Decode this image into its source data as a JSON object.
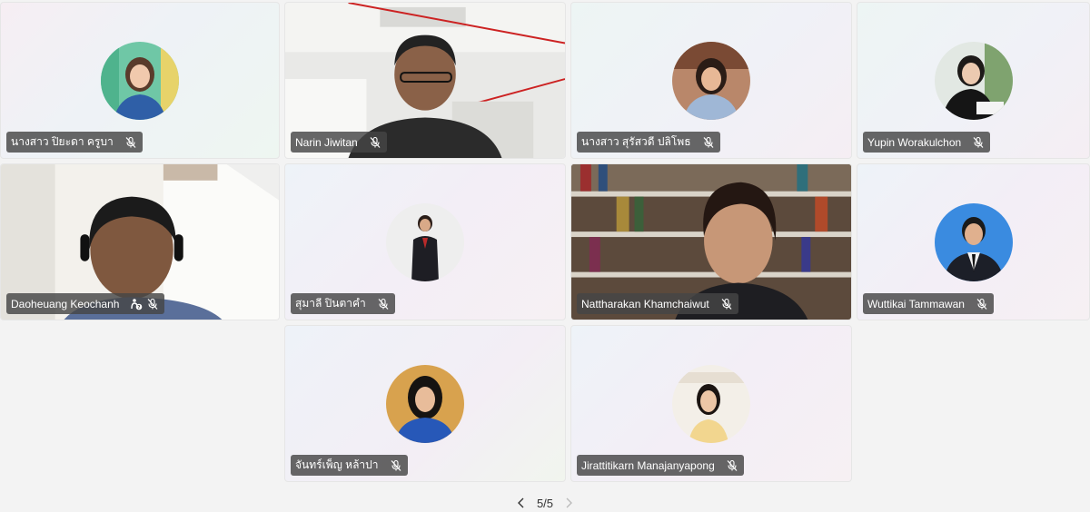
{
  "participants": [
    {
      "name": "นางสาว ปิยะดา ครูบา",
      "muted": true
    },
    {
      "name": "Narin Jiwitan",
      "muted": true
    },
    {
      "name": "นางสาว สุรัสวดี ปลิโพธ",
      "muted": true
    },
    {
      "name": "Yupin Worakulchon",
      "muted": true
    },
    {
      "name": "Daoheuang Keochanh",
      "muted": true,
      "extra_icon": "raise-hand-question-icon"
    },
    {
      "name": "สุมาลี ปินตาคำ",
      "muted": true
    },
    {
      "name": "Nattharakan Khamchaiwut",
      "muted": true
    },
    {
      "name": "Wuttikai Tammawan",
      "muted": true
    },
    {
      "name": "จันทร์เพ็ญ หล้าปา",
      "muted": true
    },
    {
      "name": "Jirattitikarn Manajanyapong",
      "muted": true
    }
  ],
  "pagination": {
    "label": "5/5"
  },
  "colors": {
    "nametag_bg": "#464646",
    "page_bg": "#f3f3f3"
  },
  "icons": [
    "mic-off-icon",
    "chevron-left-icon",
    "chevron-right-icon",
    "raise-hand-question-icon"
  ]
}
